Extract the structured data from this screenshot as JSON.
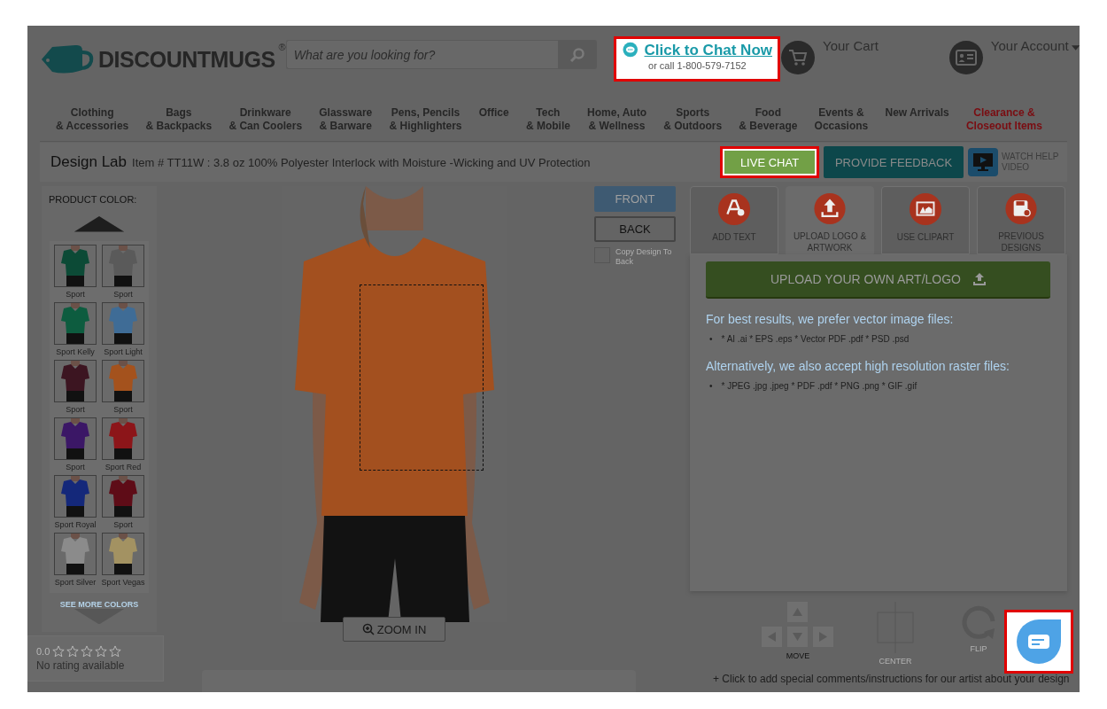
{
  "header": {
    "logo": {
      "text": "DISCOUNTMUGS",
      "mark": "®"
    },
    "search": {
      "placeholder": "What are you looking for?"
    },
    "chat_prompt": {
      "link": "Click to Chat Now",
      "phone": "or call 1-800-579-7152",
      "highlighted": true
    },
    "cart": {
      "label": "Your Cart"
    },
    "account": {
      "label": "Your Account"
    }
  },
  "nav": [
    {
      "lines": [
        "Clothing",
        "& Accessories"
      ],
      "kind": "regular"
    },
    {
      "lines": [
        "Bags",
        "& Backpacks"
      ],
      "kind": "regular"
    },
    {
      "lines": [
        "Drinkware",
        "& Can Coolers"
      ],
      "kind": "regular"
    },
    {
      "lines": [
        "Glassware",
        "& Barware"
      ],
      "kind": "regular"
    },
    {
      "lines": [
        "Pens, Pencils",
        "& Highlighters"
      ],
      "kind": "regular"
    },
    {
      "lines": [
        "Office"
      ],
      "kind": "regular"
    },
    {
      "lines": [
        "Tech",
        "& Mobile"
      ],
      "kind": "regular"
    },
    {
      "lines": [
        "Home, Auto",
        "& Wellness"
      ],
      "kind": "regular"
    },
    {
      "lines": [
        "Sports",
        "& Outdoors"
      ],
      "kind": "regular"
    },
    {
      "lines": [
        "Food",
        "& Beverage"
      ],
      "kind": "regular"
    },
    {
      "lines": [
        "Events &",
        "Occasions"
      ],
      "kind": "regular"
    },
    {
      "lines": [
        "New Arrivals"
      ],
      "kind": "regular"
    },
    {
      "lines": [
        "Clearance &",
        "Closeout Items"
      ],
      "kind": "sale"
    }
  ],
  "design_lab": {
    "title": "Design Lab",
    "item": "Item # TT11W : 3.8 oz 100% Polyester Interlock with Moisture -Wicking and UV Protection",
    "buttons": [
      {
        "label": "LIVE CHAT",
        "kind": "chat",
        "highlighted": true
      },
      {
        "label": "PROVIDE FEEDBACK",
        "kind": "feedback",
        "highlighted": false
      }
    ],
    "help_video": {
      "label": "WATCH HELP VIDEO"
    }
  },
  "colors": {
    "heading": "PRODUCT COLOR:",
    "more": "SEE MORE COLORS",
    "swatches": [
      {
        "label": "Sport",
        "color": "#0c4a36"
      },
      {
        "label": "Sport",
        "color": "#5a5a5a"
      },
      {
        "label": "Sport Kelly",
        "color": "#0d5c3f"
      },
      {
        "label": "Sport Light",
        "color": "#3f6c96"
      },
      {
        "label": "Sport",
        "color": "#3c1521"
      },
      {
        "label": "Sport",
        "color": "#a4521d"
      },
      {
        "label": "Sport",
        "color": "#3b1766"
      },
      {
        "label": "Sport Red",
        "color": "#8c1519"
      },
      {
        "label": "Sport Royal",
        "color": "#14287a"
      },
      {
        "label": "Sport",
        "color": "#5e0c17"
      },
      {
        "label": "Sport Silver",
        "color": "#8b8b8b"
      },
      {
        "label": "Sport Vegas",
        "color": "#a39262"
      }
    ]
  },
  "rating": {
    "score": "0.0",
    "stars": 0,
    "text": "No rating available"
  },
  "stage": {
    "zoom_button": "ZOOM IN",
    "sides": [
      {
        "label": "FRONT",
        "selected": true
      },
      {
        "label": "BACK",
        "selected": false
      }
    ],
    "copy_to_back": {
      "label": "Copy Design To Back",
      "checked": false
    }
  },
  "tools": {
    "tabs": [
      {
        "label": "ADD TEXT",
        "kind": "text",
        "selected": false
      },
      {
        "label": "UPLOAD LOGO & ARTWORK",
        "kind": "upload",
        "selected": true
      },
      {
        "label": "USE CLIPART",
        "kind": "clipart",
        "selected": false
      },
      {
        "label": "PREVIOUS DESIGNS",
        "kind": "designs",
        "selected": false
      }
    ],
    "upload_button": "UPLOAD YOUR OWN ART/LOGO",
    "sections": [
      {
        "heading": "For best results, we prefer vector image files:",
        "bullet": "•",
        "items": [
          "* AI .ai * EPS .eps * Vector PDF .pdf * PSD .psd"
        ]
      },
      {
        "heading": "Alternatively, we also accept high resolution raster files:",
        "bullet": "•",
        "items": [
          "* JPEG .jpg .jpeg * PDF .pdf * PNG .png * GIF .gif"
        ]
      }
    ],
    "controls": [
      {
        "label": "MOVE",
        "kind": "move",
        "disabled": false
      },
      {
        "label": "CENTER",
        "kind": "center",
        "disabled": true
      },
      {
        "label": "FLIP",
        "kind": "flip",
        "disabled": true
      }
    ],
    "comments_link": "+ Click to add special comments/instructions for our artist about your design"
  },
  "chat_fab": {
    "highlighted": true
  }
}
